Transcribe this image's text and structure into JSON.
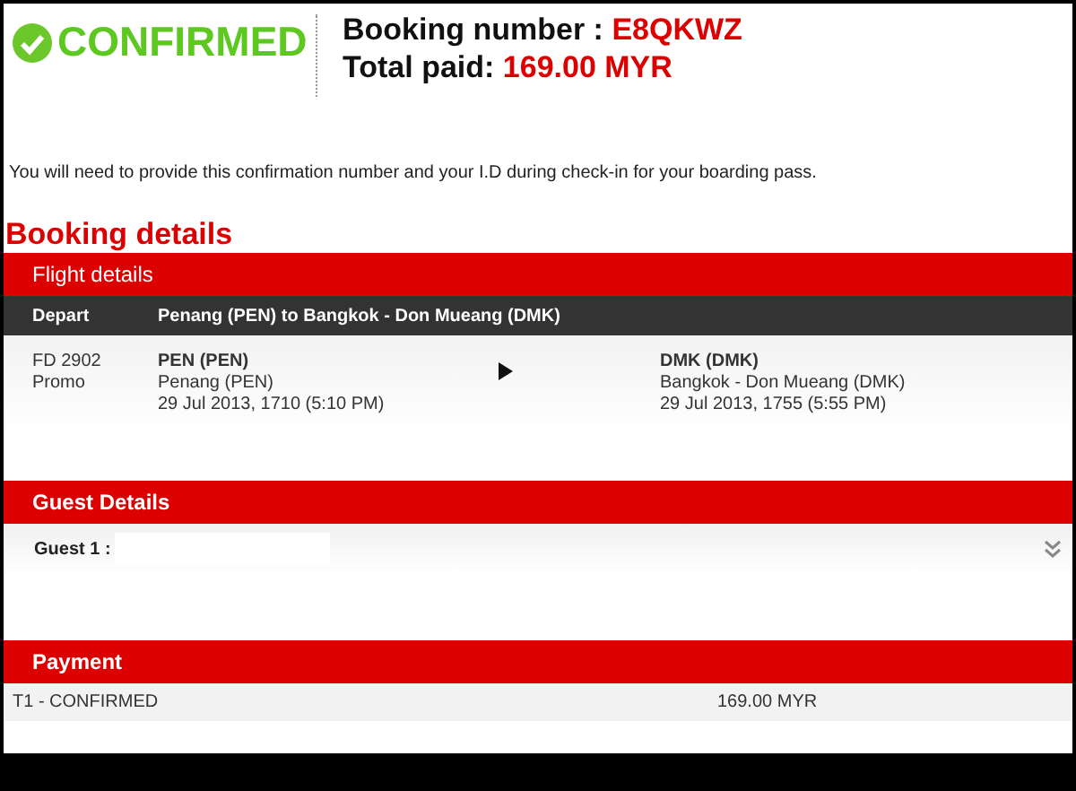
{
  "status": {
    "label": "CONFIRMED"
  },
  "booking": {
    "number_label": "Booking number :",
    "number": "E8QKWZ",
    "total_label": "Total paid:",
    "total": "169.00 MYR"
  },
  "notice": "You will need to provide this confirmation number and your I.D during check-in for your boarding pass.",
  "booking_details": {
    "title": "Booking details",
    "flight_details": {
      "title": "Flight details",
      "depart_label": "Depart",
      "route": "Penang (PEN) to Bangkok - Don Mueang (DMK)",
      "flight": {
        "number": "FD 2902",
        "fare": "Promo",
        "origin": {
          "code": "PEN (PEN)",
          "city": "Penang (PEN)",
          "time": "29 Jul 2013, 1710 (5:10 PM)"
        },
        "destination": {
          "code": "DMK (DMK)",
          "city": "Bangkok - Don Mueang (DMK)",
          "time": "29 Jul 2013, 1755 (5:55 PM)"
        }
      }
    },
    "guest_details": {
      "title": "Guest Details",
      "guests": [
        {
          "label": "Guest 1 :"
        }
      ]
    },
    "payment": {
      "title": "Payment",
      "rows": [
        {
          "description": "T1 - CONFIRMED",
          "amount": "169.00 MYR"
        }
      ]
    }
  }
}
